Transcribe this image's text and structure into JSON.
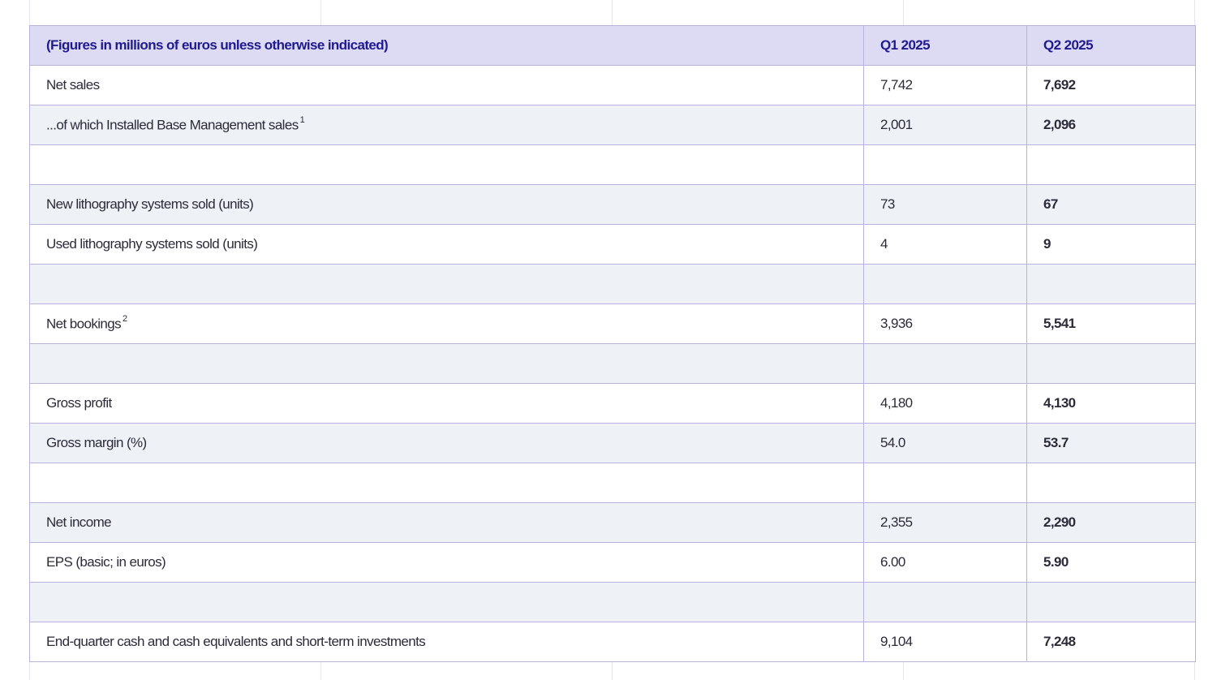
{
  "table": {
    "headers": {
      "label": "(Figures in millions of euros unless otherwise indicated)",
      "q1": "Q1 2025",
      "q2": "Q2 2025"
    },
    "rows": [
      {
        "label": "Net sales",
        "sup": "",
        "q1": "7,742",
        "q2": "7,692"
      },
      {
        "label": "...of which Installed Base Management sales",
        "sup": "1",
        "q1": "2,001",
        "q2": "2,096"
      },
      {
        "label": "",
        "sup": "",
        "q1": "",
        "q2": ""
      },
      {
        "label": "New lithography systems sold (units)",
        "sup": "",
        "q1": "73",
        "q2": "67"
      },
      {
        "label": "Used lithography systems sold (units)",
        "sup": "",
        "q1": "4",
        "q2": "9"
      },
      {
        "label": "",
        "sup": "",
        "q1": "",
        "q2": ""
      },
      {
        "label": "Net bookings",
        "sup": "2",
        "q1": "3,936",
        "q2": "5,541"
      },
      {
        "label": "",
        "sup": "",
        "q1": "",
        "q2": ""
      },
      {
        "label": "Gross profit",
        "sup": "",
        "q1": "4,180",
        "q2": "4,130"
      },
      {
        "label": "Gross margin (%)",
        "sup": "",
        "q1": "54.0",
        "q2": "53.7"
      },
      {
        "label": "",
        "sup": "",
        "q1": "",
        "q2": ""
      },
      {
        "label": "Net income",
        "sup": "",
        "q1": "2,355",
        "q2": "2,290"
      },
      {
        "label": "EPS (basic; in euros)",
        "sup": "",
        "q1": "6.00",
        "q2": "5.90"
      },
      {
        "label": "",
        "sup": "",
        "q1": "",
        "q2": ""
      },
      {
        "label": "End-quarter cash and cash equivalents and short-term investments",
        "sup": "",
        "q1": "9,104",
        "q2": "7,248"
      }
    ]
  }
}
